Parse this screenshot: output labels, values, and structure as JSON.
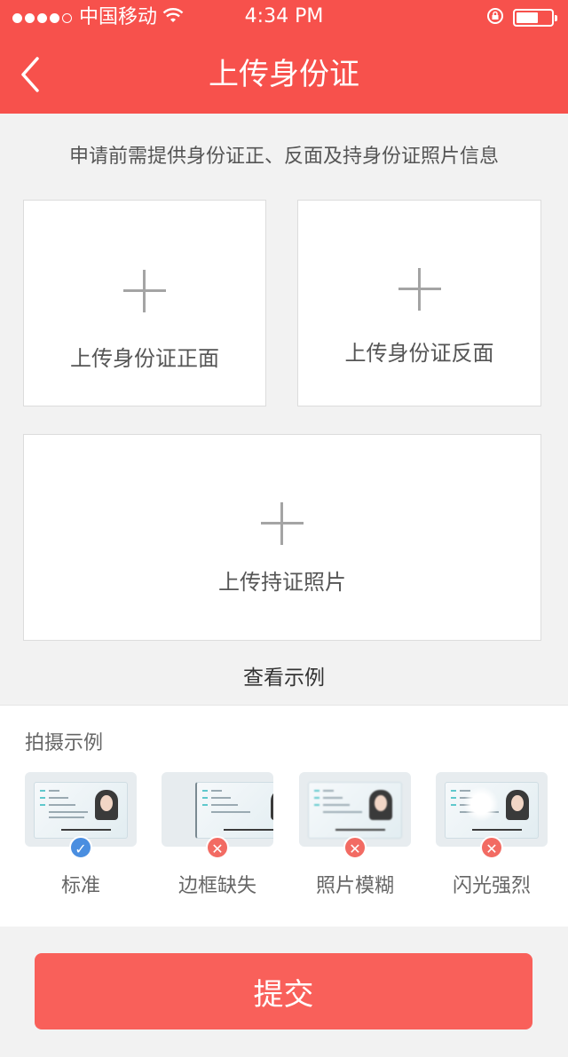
{
  "status_bar": {
    "carrier": "中国移动",
    "time": "4:34 PM",
    "signal_bars_filled": 4,
    "signal_bars_total": 5
  },
  "nav": {
    "title": "上传身份证",
    "back_icon": "chevron-left-icon"
  },
  "intro_text": "申请前需提供身份证正、反面及持身份证照片信息",
  "upload_cards": {
    "front_label": "上传身份证正面",
    "back_label": "上传身份证反面",
    "hold_label": "上传持证照片"
  },
  "view_example_label": "查看示例",
  "examples": {
    "title": "拍摄示例",
    "items": [
      {
        "label": "标准",
        "status_icon": "check-icon",
        "symbol": "✓"
      },
      {
        "label": "边框缺失",
        "status_icon": "close-icon",
        "symbol": "✕"
      },
      {
        "label": "照片模糊",
        "status_icon": "close-icon",
        "symbol": "✕"
      },
      {
        "label": "闪光强烈",
        "status_icon": "close-icon",
        "symbol": "✕"
      }
    ]
  },
  "submit_label": "提交",
  "colors": {
    "brand_red": "#f7514c",
    "submit_red": "#f9605a",
    "ok_blue": "#4a8ee0",
    "error_red": "#f26b63"
  }
}
